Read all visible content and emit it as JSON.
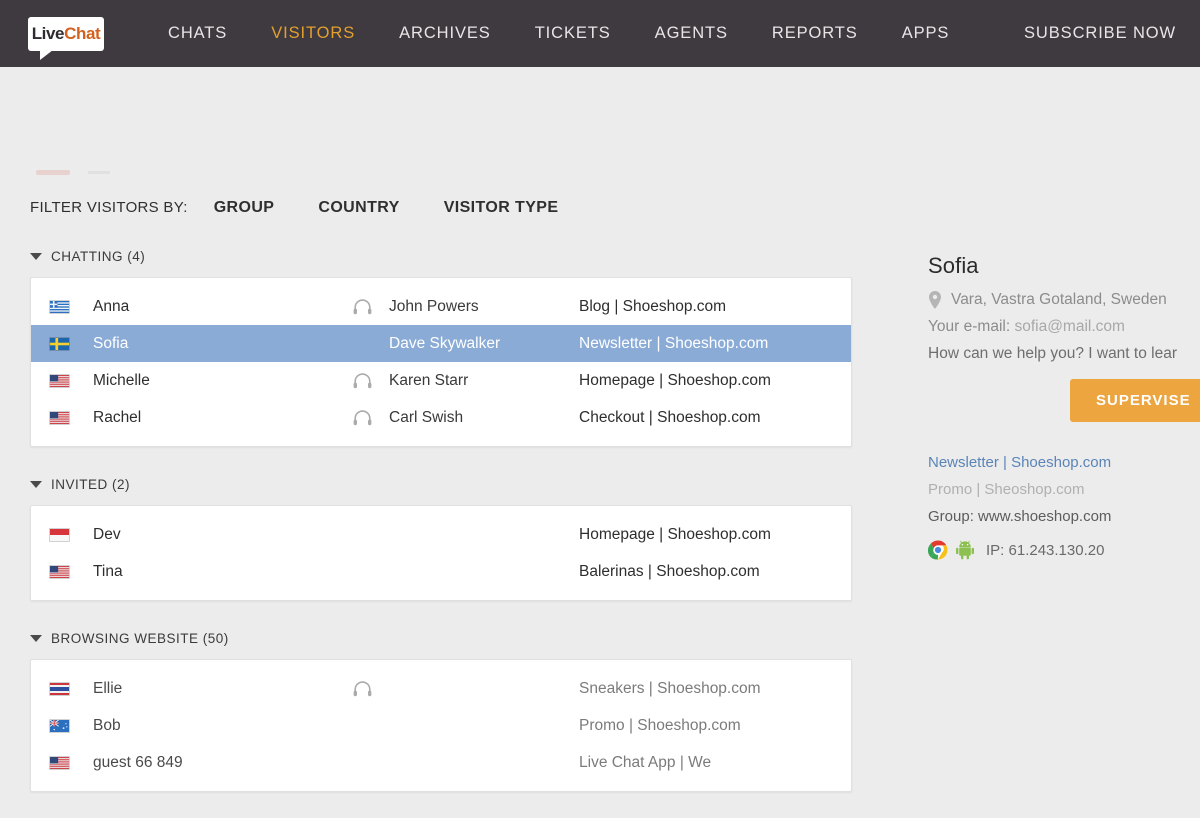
{
  "topbar": {
    "logo": {
      "part1": "Live",
      "part2": "Chat"
    },
    "nav": [
      {
        "label": "CHATS",
        "active": false
      },
      {
        "label": "VISITORS",
        "active": true
      },
      {
        "label": "ARCHIVES",
        "active": false
      },
      {
        "label": "TICKETS",
        "active": false
      },
      {
        "label": "AGENTS",
        "active": false
      },
      {
        "label": "REPORTS",
        "active": false
      },
      {
        "label": "APPS",
        "active": false
      }
    ],
    "subscribe_label": "SUBSCRIBE NOW",
    "background": "#3e3a3f",
    "accent": "#e3a02f"
  },
  "filters": {
    "label": "FILTER VISITORS BY:",
    "options": [
      {
        "label": "GROUP"
      },
      {
        "label": "COUNTRY"
      },
      {
        "label": "VISITOR TYPE"
      }
    ]
  },
  "sections": [
    {
      "title": "CHATTING (4)",
      "expanded": true,
      "rows": [
        {
          "flag": "greece-flag",
          "name": "Anna",
          "headset": true,
          "agent": "John Powers",
          "page": "Blog | Shoeshop.com",
          "selected": false,
          "dim": false
        },
        {
          "flag": "sweden-flag",
          "name": "Sofia",
          "headset": false,
          "agent": "Dave Skywalker",
          "page": "Newsletter | Shoeshop.com",
          "selected": true,
          "dim": false
        },
        {
          "flag": "usa-flag",
          "name": "Michelle",
          "headset": true,
          "agent": "Karen Starr",
          "page": "Homepage | Shoeshop.com",
          "selected": false,
          "dim": false
        },
        {
          "flag": "usa-flag",
          "name": "Rachel",
          "headset": true,
          "agent": "Carl Swish",
          "page": "Checkout | Shoeshop.com",
          "selected": false,
          "dim": false
        }
      ]
    },
    {
      "title": "INVITED (2)",
      "expanded": true,
      "rows": [
        {
          "flag": "indonesia-flag",
          "name": "Dev",
          "headset": false,
          "agent": "",
          "page": "Homepage | Shoeshop.com",
          "selected": false,
          "dim": false
        },
        {
          "flag": "usa-flag",
          "name": "Tina",
          "headset": false,
          "agent": "",
          "page": "Balerinas | Shoeshop.com",
          "selected": false,
          "dim": false
        }
      ]
    },
    {
      "title": "BROWSING WEBSITE (50)",
      "expanded": true,
      "rows": [
        {
          "flag": "thailand-flag",
          "name": "Ellie",
          "headset": true,
          "agent": "",
          "page": "Sneakers | Shoeshop.com",
          "selected": false,
          "dim": true
        },
        {
          "flag": "australia-flag",
          "name": "Bob",
          "headset": false,
          "agent": "",
          "page": "Promo | Shoeshop.com",
          "selected": false,
          "dim": true
        },
        {
          "flag": "usa-flag",
          "name": "guest 66 849",
          "headset": false,
          "agent": "",
          "page": "Live Chat App | We",
          "selected": false,
          "dim": true
        }
      ]
    }
  ],
  "detail": {
    "name": "Sofia",
    "location": "Vara, Vastra Gotaland, Sweden",
    "email_label": "Your e-mail:",
    "email_value": "sofia@mail.com",
    "question": "How can we help you? I want to lear",
    "supervise_label": "SUPERVISE",
    "current_page": "Newsletter | Shoeshop.com",
    "previous_page": "Promo | Sheoshop.com",
    "group": "Group: www.shoeshop.com",
    "ip": "IP: 61.243.130.20",
    "browser_icon": "chrome-icon",
    "os_icon": "android-icon",
    "accent_button": "#eda53f",
    "link_color": "#5a84b8"
  }
}
